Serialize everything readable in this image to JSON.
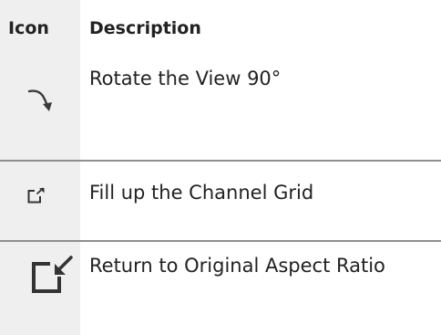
{
  "table": {
    "header": {
      "icon_label": "Icon",
      "description_label": "Description"
    },
    "rows": [
      {
        "icon": "rotate-arrow-icon",
        "description": "Rotate the View 90°"
      },
      {
        "icon": "fill-grid-icon",
        "description": "Fill up the Channel Grid"
      },
      {
        "icon": "original-aspect-icon",
        "description": "Return to Original Aspect Ratio"
      }
    ]
  }
}
